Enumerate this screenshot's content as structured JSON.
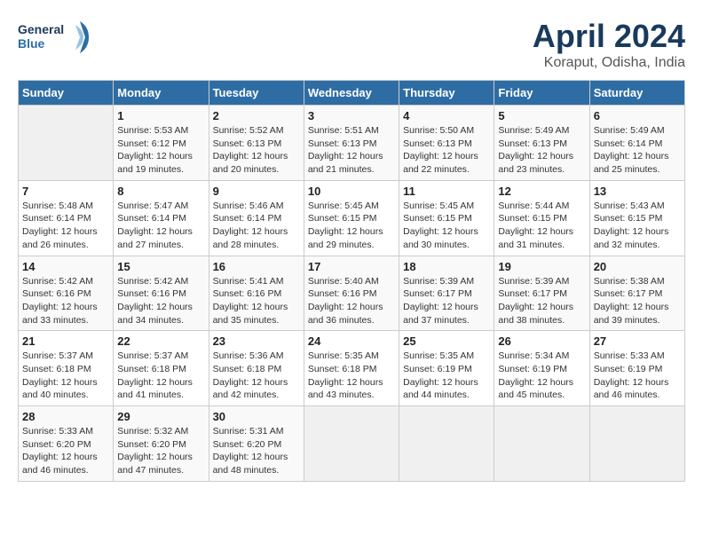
{
  "header": {
    "logo_line1": "General",
    "logo_line2": "Blue",
    "title": "April 2024",
    "subtitle": "Koraput, Odisha, India"
  },
  "days_of_week": [
    "Sunday",
    "Monday",
    "Tuesday",
    "Wednesday",
    "Thursday",
    "Friday",
    "Saturday"
  ],
  "weeks": [
    [
      {
        "day": "",
        "info": ""
      },
      {
        "day": "1",
        "info": "Sunrise: 5:53 AM\nSunset: 6:12 PM\nDaylight: 12 hours\nand 19 minutes."
      },
      {
        "day": "2",
        "info": "Sunrise: 5:52 AM\nSunset: 6:13 PM\nDaylight: 12 hours\nand 20 minutes."
      },
      {
        "day": "3",
        "info": "Sunrise: 5:51 AM\nSunset: 6:13 PM\nDaylight: 12 hours\nand 21 minutes."
      },
      {
        "day": "4",
        "info": "Sunrise: 5:50 AM\nSunset: 6:13 PM\nDaylight: 12 hours\nand 22 minutes."
      },
      {
        "day": "5",
        "info": "Sunrise: 5:49 AM\nSunset: 6:13 PM\nDaylight: 12 hours\nand 23 minutes."
      },
      {
        "day": "6",
        "info": "Sunrise: 5:49 AM\nSunset: 6:14 PM\nDaylight: 12 hours\nand 25 minutes."
      }
    ],
    [
      {
        "day": "7",
        "info": "Sunrise: 5:48 AM\nSunset: 6:14 PM\nDaylight: 12 hours\nand 26 minutes."
      },
      {
        "day": "8",
        "info": "Sunrise: 5:47 AM\nSunset: 6:14 PM\nDaylight: 12 hours\nand 27 minutes."
      },
      {
        "day": "9",
        "info": "Sunrise: 5:46 AM\nSunset: 6:14 PM\nDaylight: 12 hours\nand 28 minutes."
      },
      {
        "day": "10",
        "info": "Sunrise: 5:45 AM\nSunset: 6:15 PM\nDaylight: 12 hours\nand 29 minutes."
      },
      {
        "day": "11",
        "info": "Sunrise: 5:45 AM\nSunset: 6:15 PM\nDaylight: 12 hours\nand 30 minutes."
      },
      {
        "day": "12",
        "info": "Sunrise: 5:44 AM\nSunset: 6:15 PM\nDaylight: 12 hours\nand 31 minutes."
      },
      {
        "day": "13",
        "info": "Sunrise: 5:43 AM\nSunset: 6:15 PM\nDaylight: 12 hours\nand 32 minutes."
      }
    ],
    [
      {
        "day": "14",
        "info": "Sunrise: 5:42 AM\nSunset: 6:16 PM\nDaylight: 12 hours\nand 33 minutes."
      },
      {
        "day": "15",
        "info": "Sunrise: 5:42 AM\nSunset: 6:16 PM\nDaylight: 12 hours\nand 34 minutes."
      },
      {
        "day": "16",
        "info": "Sunrise: 5:41 AM\nSunset: 6:16 PM\nDaylight: 12 hours\nand 35 minutes."
      },
      {
        "day": "17",
        "info": "Sunrise: 5:40 AM\nSunset: 6:16 PM\nDaylight: 12 hours\nand 36 minutes."
      },
      {
        "day": "18",
        "info": "Sunrise: 5:39 AM\nSunset: 6:17 PM\nDaylight: 12 hours\nand 37 minutes."
      },
      {
        "day": "19",
        "info": "Sunrise: 5:39 AM\nSunset: 6:17 PM\nDaylight: 12 hours\nand 38 minutes."
      },
      {
        "day": "20",
        "info": "Sunrise: 5:38 AM\nSunset: 6:17 PM\nDaylight: 12 hours\nand 39 minutes."
      }
    ],
    [
      {
        "day": "21",
        "info": "Sunrise: 5:37 AM\nSunset: 6:18 PM\nDaylight: 12 hours\nand 40 minutes."
      },
      {
        "day": "22",
        "info": "Sunrise: 5:37 AM\nSunset: 6:18 PM\nDaylight: 12 hours\nand 41 minutes."
      },
      {
        "day": "23",
        "info": "Sunrise: 5:36 AM\nSunset: 6:18 PM\nDaylight: 12 hours\nand 42 minutes."
      },
      {
        "day": "24",
        "info": "Sunrise: 5:35 AM\nSunset: 6:18 PM\nDaylight: 12 hours\nand 43 minutes."
      },
      {
        "day": "25",
        "info": "Sunrise: 5:35 AM\nSunset: 6:19 PM\nDaylight: 12 hours\nand 44 minutes."
      },
      {
        "day": "26",
        "info": "Sunrise: 5:34 AM\nSunset: 6:19 PM\nDaylight: 12 hours\nand 45 minutes."
      },
      {
        "day": "27",
        "info": "Sunrise: 5:33 AM\nSunset: 6:19 PM\nDaylight: 12 hours\nand 46 minutes."
      }
    ],
    [
      {
        "day": "28",
        "info": "Sunrise: 5:33 AM\nSunset: 6:20 PM\nDaylight: 12 hours\nand 46 minutes."
      },
      {
        "day": "29",
        "info": "Sunrise: 5:32 AM\nSunset: 6:20 PM\nDaylight: 12 hours\nand 47 minutes."
      },
      {
        "day": "30",
        "info": "Sunrise: 5:31 AM\nSunset: 6:20 PM\nDaylight: 12 hours\nand 48 minutes."
      },
      {
        "day": "",
        "info": ""
      },
      {
        "day": "",
        "info": ""
      },
      {
        "day": "",
        "info": ""
      },
      {
        "day": "",
        "info": ""
      }
    ]
  ]
}
